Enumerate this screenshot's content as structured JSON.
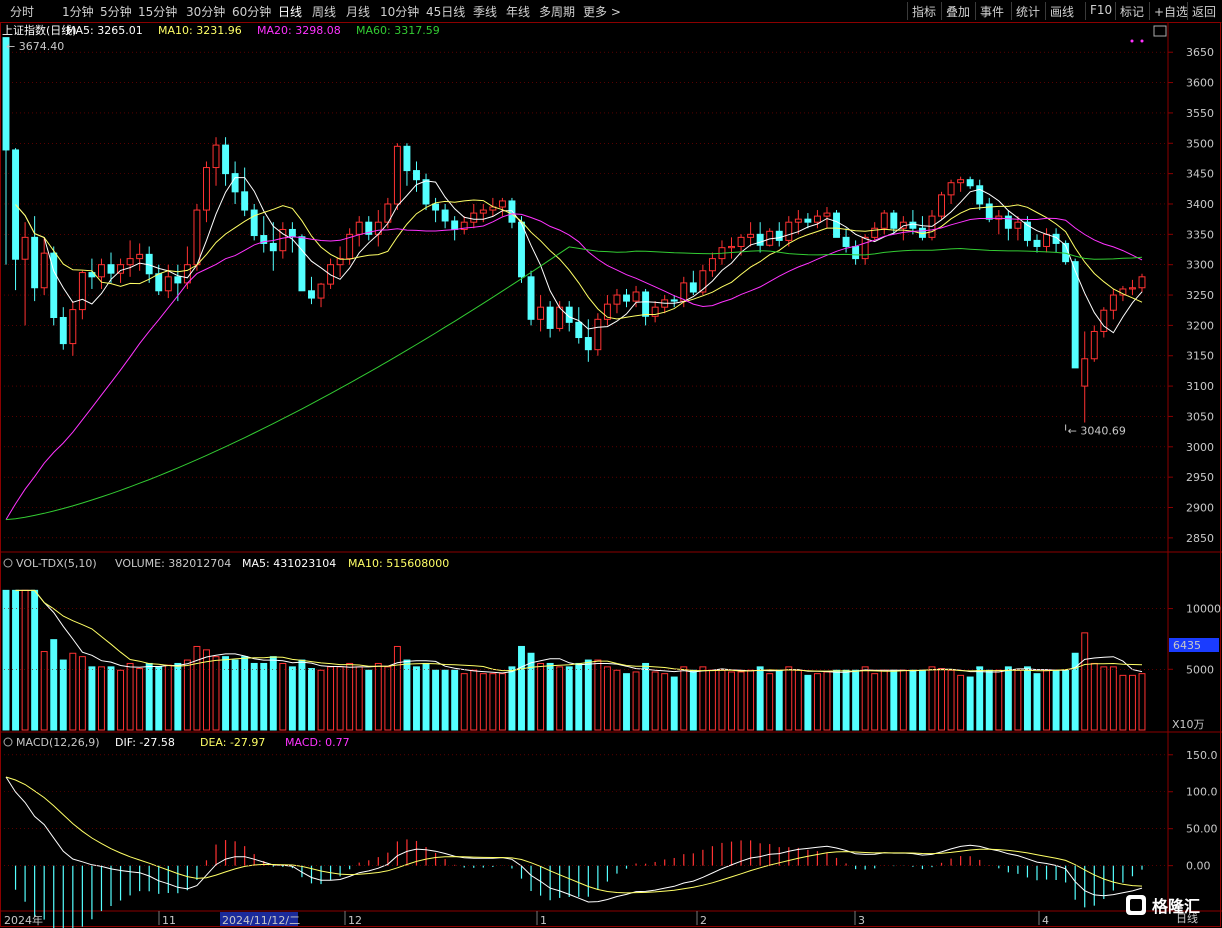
{
  "toolbar": {
    "left_items": [
      "分时",
      "1分钟",
      "5分钟",
      "15分钟",
      "30分钟",
      "60分钟",
      "日线",
      "周线",
      "月线",
      "10分钟",
      "45日线",
      "季线",
      "年线",
      "多周期",
      "更多 >"
    ],
    "active": "日线",
    "right_items": [
      "指标",
      "叠加",
      "事件",
      "统计",
      "画线",
      "F10",
      "标记",
      "+自选",
      "返回"
    ]
  },
  "price_panel": {
    "name": "上证指数(日线)",
    "ma5_label": "MA5: 3265.01",
    "ma10_label": "MA10: 3231.96",
    "ma20_label": "MA20: 3298.08",
    "ma60_label": "MA60: 3317.59",
    "high_label": "3674.40",
    "low_label": "3040.69",
    "ticks": [
      "3650",
      "3600",
      "3550",
      "3500",
      "3450",
      "3400",
      "3350",
      "3300",
      "3250",
      "3200",
      "3150",
      "3100",
      "3050",
      "3000",
      "2950",
      "2900",
      "2850"
    ]
  },
  "volume_panel": {
    "label_prefix": "VOL-TDX(5,10)",
    "volume_label": "VOLUME: 382012704",
    "ma5_label": "MA5: 431023104",
    "ma10_label": "MA10: 515608000",
    "ticks": [
      "10000",
      "5000"
    ],
    "current_box": "6435",
    "unit": "X10万"
  },
  "macd_panel": {
    "label_prefix": "MACD(12,26,9)",
    "dif_label": "DIF: -27.58",
    "dea_label": "DEA: -27.97",
    "macd_label": "MACD: 0.77",
    "ticks": [
      "150.0",
      "100.0",
      "50.00",
      "0.00"
    ]
  },
  "date_axis": {
    "year_label": "2024年",
    "months": [
      "11",
      "12",
      "1",
      "2",
      "3",
      "4"
    ],
    "cursor_date": "2024/11/12/二",
    "period_label": "日线"
  },
  "watermark": "格隆汇",
  "colors": {
    "up": "#ff3232",
    "down": "#54ffff",
    "ma5": "#ffffff",
    "ma10": "#ffff66",
    "ma20": "#ff33ff",
    "ma60": "#33cc33",
    "grid": "#8b0000",
    "bg": "#000000"
  },
  "chart_data": {
    "type": "candlestick",
    "series_approx": "daily candles Oct 2024 – Apr 2025, values read from chart (approximate)",
    "ohlc": [
      [
        3674,
        3674,
        3300,
        3489
      ],
      [
        3489,
        3492,
        3258,
        3309
      ],
      [
        3309,
        3370,
        3200,
        3345
      ],
      [
        3345,
        3380,
        3240,
        3262
      ],
      [
        3262,
        3345,
        3250,
        3319
      ],
      [
        3319,
        3330,
        3200,
        3213
      ],
      [
        3213,
        3230,
        3160,
        3170
      ],
      [
        3170,
        3240,
        3150,
        3226
      ],
      [
        3226,
        3290,
        3210,
        3287
      ],
      [
        3287,
        3310,
        3260,
        3280
      ],
      [
        3280,
        3310,
        3260,
        3300
      ],
      [
        3300,
        3320,
        3270,
        3286
      ],
      [
        3286,
        3310,
        3270,
        3300
      ],
      [
        3300,
        3340,
        3280,
        3310
      ],
      [
        3310,
        3335,
        3290,
        3317
      ],
      [
        3317,
        3330,
        3270,
        3285
      ],
      [
        3285,
        3300,
        3250,
        3257
      ],
      [
        3257,
        3300,
        3245,
        3280
      ],
      [
        3280,
        3300,
        3240,
        3270
      ],
      [
        3270,
        3330,
        3260,
        3300
      ],
      [
        3300,
        3400,
        3290,
        3390
      ],
      [
        3390,
        3470,
        3370,
        3460
      ],
      [
        3460,
        3510,
        3430,
        3497
      ],
      [
        3497,
        3510,
        3430,
        3450
      ],
      [
        3450,
        3470,
        3400,
        3420
      ],
      [
        3420,
        3460,
        3380,
        3390
      ],
      [
        3390,
        3400,
        3340,
        3348
      ],
      [
        3348,
        3380,
        3320,
        3335
      ],
      [
        3335,
        3370,
        3290,
        3323
      ],
      [
        3323,
        3370,
        3310,
        3358
      ],
      [
        3358,
        3370,
        3320,
        3346
      ],
      [
        3346,
        3350,
        3280,
        3257
      ],
      [
        3257,
        3280,
        3235,
        3245
      ],
      [
        3245,
        3270,
        3230,
        3268
      ],
      [
        3268,
        3310,
        3260,
        3300
      ],
      [
        3300,
        3330,
        3280,
        3310
      ],
      [
        3310,
        3360,
        3300,
        3350
      ],
      [
        3350,
        3380,
        3330,
        3370
      ],
      [
        3370,
        3380,
        3340,
        3350
      ],
      [
        3350,
        3390,
        3330,
        3370
      ],
      [
        3370,
        3410,
        3360,
        3400
      ],
      [
        3400,
        3500,
        3390,
        3495
      ],
      [
        3495,
        3500,
        3430,
        3455
      ],
      [
        3455,
        3470,
        3420,
        3440
      ],
      [
        3440,
        3450,
        3390,
        3400
      ],
      [
        3400,
        3410,
        3370,
        3390
      ],
      [
        3390,
        3400,
        3360,
        3372
      ],
      [
        3372,
        3380,
        3340,
        3358
      ],
      [
        3358,
        3380,
        3350,
        3370
      ],
      [
        3370,
        3400,
        3360,
        3385
      ],
      [
        3385,
        3400,
        3370,
        3390
      ],
      [
        3390,
        3410,
        3380,
        3395
      ],
      [
        3395,
        3410,
        3380,
        3405
      ],
      [
        3405,
        3410,
        3360,
        3370
      ],
      [
        3370,
        3380,
        3270,
        3280
      ],
      [
        3280,
        3290,
        3200,
        3210
      ],
      [
        3210,
        3250,
        3190,
        3230
      ],
      [
        3230,
        3240,
        3180,
        3195
      ],
      [
        3195,
        3240,
        3190,
        3230
      ],
      [
        3230,
        3240,
        3190,
        3205
      ],
      [
        3205,
        3230,
        3170,
        3180
      ],
      [
        3180,
        3210,
        3140,
        3160
      ],
      [
        3160,
        3220,
        3150,
        3210
      ],
      [
        3210,
        3250,
        3200,
        3235
      ],
      [
        3235,
        3260,
        3220,
        3250
      ],
      [
        3250,
        3260,
        3230,
        3240
      ],
      [
        3240,
        3265,
        3230,
        3255
      ],
      [
        3255,
        3260,
        3200,
        3215
      ],
      [
        3215,
        3240,
        3205,
        3230
      ],
      [
        3230,
        3250,
        3220,
        3242
      ],
      [
        3242,
        3250,
        3230,
        3240
      ],
      [
        3240,
        3280,
        3230,
        3270
      ],
      [
        3270,
        3290,
        3250,
        3255
      ],
      [
        3255,
        3300,
        3250,
        3290
      ],
      [
        3290,
        3320,
        3280,
        3310
      ],
      [
        3310,
        3340,
        3300,
        3328
      ],
      [
        3328,
        3345,
        3310,
        3330
      ],
      [
        3330,
        3350,
        3315,
        3345
      ],
      [
        3345,
        3370,
        3330,
        3350
      ],
      [
        3350,
        3370,
        3320,
        3332
      ],
      [
        3332,
        3360,
        3330,
        3355
      ],
      [
        3355,
        3370,
        3330,
        3340
      ],
      [
        3340,
        3380,
        3330,
        3370
      ],
      [
        3370,
        3390,
        3350,
        3375
      ],
      [
        3375,
        3385,
        3360,
        3370
      ],
      [
        3370,
        3390,
        3360,
        3380
      ],
      [
        3380,
        3395,
        3360,
        3385
      ],
      [
        3385,
        3390,
        3350,
        3345
      ],
      [
        3345,
        3360,
        3320,
        3330
      ],
      [
        3330,
        3340,
        3300,
        3310
      ],
      [
        3310,
        3350,
        3300,
        3345
      ],
      [
        3345,
        3370,
        3340,
        3360
      ],
      [
        3360,
        3390,
        3350,
        3385
      ],
      [
        3385,
        3390,
        3350,
        3360
      ],
      [
        3360,
        3380,
        3340,
        3370
      ],
      [
        3370,
        3390,
        3350,
        3360
      ],
      [
        3360,
        3380,
        3340,
        3345
      ],
      [
        3345,
        3390,
        3340,
        3380
      ],
      [
        3380,
        3420,
        3375,
        3415
      ],
      [
        3415,
        3440,
        3400,
        3435
      ],
      [
        3435,
        3445,
        3420,
        3440
      ],
      [
        3440,
        3445,
        3425,
        3430
      ],
      [
        3430,
        3440,
        3390,
        3400
      ],
      [
        3400,
        3410,
        3370,
        3375
      ],
      [
        3375,
        3390,
        3350,
        3380
      ],
      [
        3380,
        3390,
        3340,
        3360
      ],
      [
        3360,
        3380,
        3340,
        3370
      ],
      [
        3370,
        3380,
        3330,
        3340
      ],
      [
        3340,
        3350,
        3320,
        3330
      ],
      [
        3330,
        3360,
        3320,
        3350
      ],
      [
        3350,
        3360,
        3320,
        3335
      ],
      [
        3335,
        3340,
        3300,
        3305
      ],
      [
        3305,
        3310,
        3220,
        3130
      ],
      [
        3100,
        3190,
        3040,
        3145
      ],
      [
        3145,
        3200,
        3140,
        3190
      ],
      [
        3190,
        3230,
        3180,
        3225
      ],
      [
        3225,
        3260,
        3210,
        3250
      ],
      [
        3250,
        3265,
        3240,
        3260
      ],
      [
        3260,
        3275,
        3250,
        3262
      ],
      [
        3262,
        3285,
        3255,
        3280
      ]
    ],
    "price_ylim": [
      2830,
      3680
    ],
    "volume_range_x10wan": [
      0,
      14000
    ],
    "macd_range": [
      -60,
      170
    ]
  }
}
